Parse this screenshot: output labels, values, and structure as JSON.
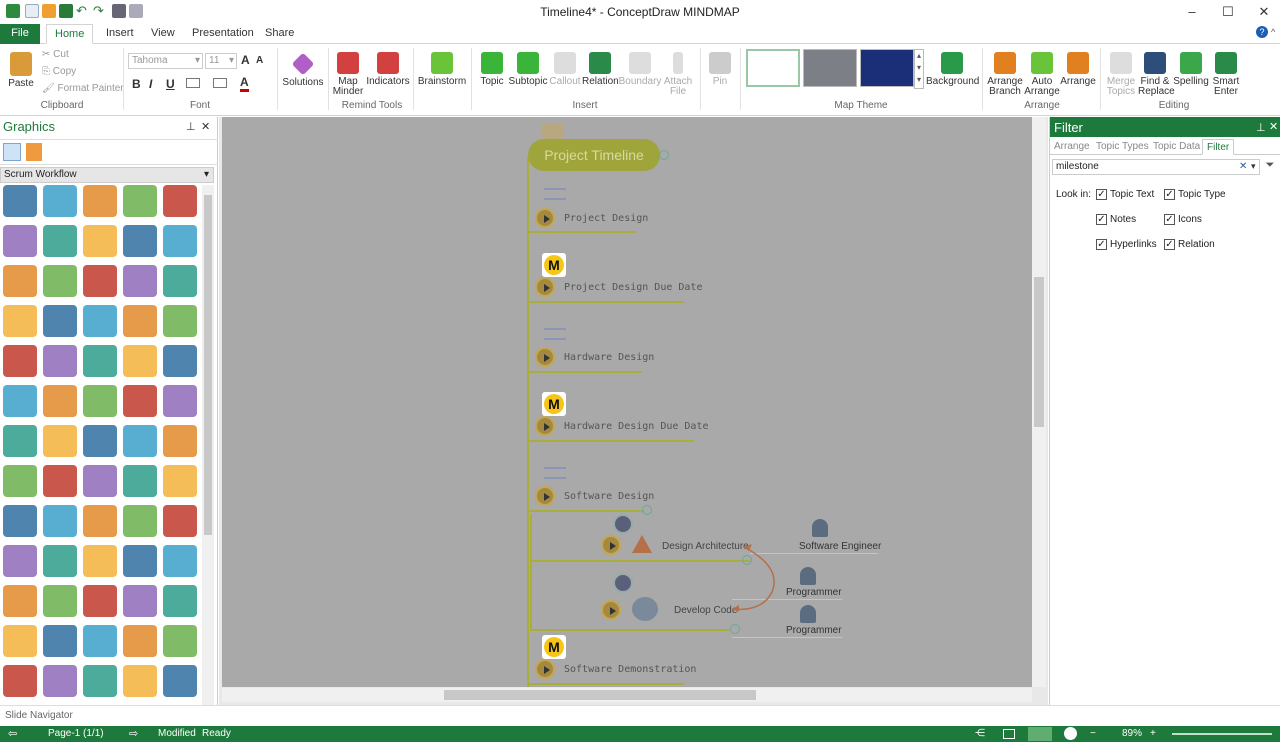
{
  "app": {
    "title": "Timeline4* - ConceptDraw MINDMAP"
  },
  "tabs": {
    "file": "File",
    "home": "Home",
    "insert": "Insert",
    "view": "View",
    "presentation": "Presentation",
    "share": "Share"
  },
  "ribbon": {
    "clipboard": {
      "paste": "Paste",
      "cut": "Cut",
      "copy": "Copy",
      "format_painter": "Format Painter",
      "label": "Clipboard"
    },
    "font": {
      "family": "Tahoma",
      "size": "11",
      "bold": "B",
      "italic": "I",
      "underline": "U",
      "label": "Font"
    },
    "solutions": "Solutions",
    "remind": {
      "map_minder": "Map Minder",
      "indicators": "Indicators",
      "label": "Remind Tools"
    },
    "brainstorm": "Brainstorm",
    "insert": {
      "topic": "Topic",
      "subtopic": "Subtopic",
      "callout": "Callout",
      "relation": "Relation",
      "boundary": "Boundary",
      "attach_file": "Attach File",
      "label": "Insert"
    },
    "pin": "Pin",
    "theme": {
      "label": "Map Theme",
      "background": "Background"
    },
    "arrange": {
      "arrange_branch": "Arrange Branch",
      "auto_arrange": "Auto Arrange",
      "arrange": "Arrange",
      "label": "Arrange"
    },
    "editing": {
      "merge_topics": "Merge Topics",
      "find_replace": "Find & Replace",
      "spelling": "Spelling",
      "smart_enter": "Smart Enter",
      "label": "Editing"
    }
  },
  "graphics": {
    "title": "Graphics",
    "library": "Scrum Workflow"
  },
  "map": {
    "root": "Project Timeline",
    "topics": [
      "Project Design",
      "Project Design Due Date",
      "Hardware Design",
      "Hardware Design Due Date",
      "Software Design",
      "Software  Demonstration"
    ],
    "subtopics": [
      "Design Architecture",
      "Develop Code"
    ],
    "resources": [
      "Software Engineer",
      "Programmer",
      "Programmer"
    ],
    "milestone_letter": "M"
  },
  "filter": {
    "title": "Filter",
    "tabs": [
      "Arrange",
      "Topic Types",
      "Topic Data",
      "Filter"
    ],
    "search_value": "milestone",
    "look_in_label": "Look in:",
    "options": [
      {
        "label": "Topic Text",
        "checked": true
      },
      {
        "label": "Topic Type",
        "checked": true
      },
      {
        "label": "Notes",
        "checked": true
      },
      {
        "label": "Icons",
        "checked": true
      },
      {
        "label": "Hyperlinks",
        "checked": true
      },
      {
        "label": "Relation",
        "checked": true
      }
    ]
  },
  "slide_navigator": "Slide Navigator",
  "status": {
    "page": "Page-1 (1/1)",
    "modified": "Modified",
    "ready": "Ready",
    "zoom": "89%"
  },
  "colors": {
    "brand": "#1e7a3c",
    "canvas": "#a9a9a9",
    "branch": "#a9ad3a"
  }
}
